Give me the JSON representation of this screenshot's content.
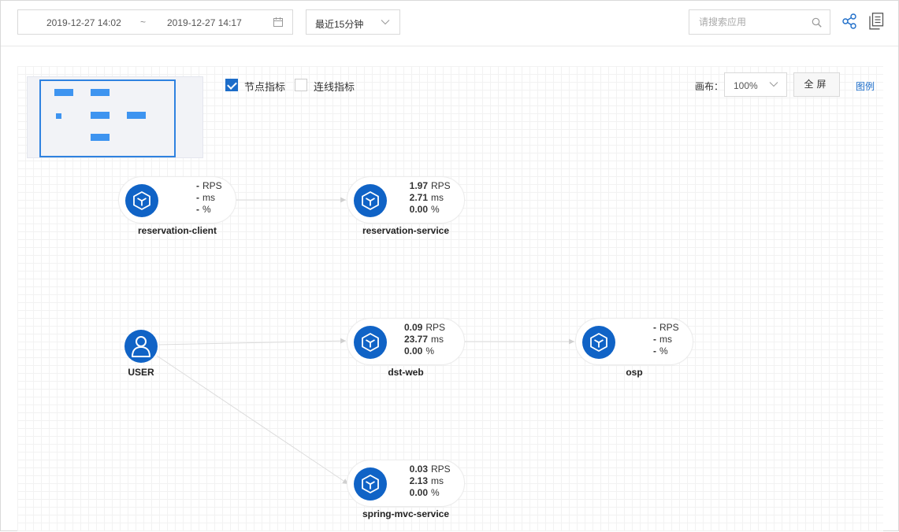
{
  "toolbar": {
    "time_range": {
      "start": "2019-12-27 14:02",
      "separator": "~",
      "end": "2019-12-27 14:17"
    },
    "period": "最近15分钟",
    "search_placeholder": "请搜索应用"
  },
  "options": {
    "node_metrics": {
      "label": "节点指标",
      "checked": true
    },
    "link_metrics": {
      "label": "连线指标",
      "checked": false
    }
  },
  "canvas_controls": {
    "canvas_label": "画布：",
    "zoom": "100%",
    "fullscreen": "全屏",
    "legend": "图例"
  },
  "colors": {
    "accent": "#1063c6",
    "minimap_block": "#3e94f0"
  },
  "graph": {
    "user": {
      "name": "USER",
      "icon": "user-icon"
    },
    "nodes": [
      {
        "id": "reservation-client",
        "name": "reservation-client",
        "icon": "cube-icon",
        "rps": "-",
        "rps_unit": "RPS",
        "ms": "-",
        "ms_unit": "ms",
        "err": "-",
        "err_unit": "%"
      },
      {
        "id": "reservation-service",
        "name": "reservation-service",
        "icon": "cube-icon",
        "rps": "1.97",
        "rps_unit": "RPS",
        "ms": "2.71",
        "ms_unit": "ms",
        "err": "0.00",
        "err_unit": "%"
      },
      {
        "id": "dst-web",
        "name": "dst-web",
        "icon": "cube-icon",
        "rps": "0.09",
        "rps_unit": "RPS",
        "ms": "23.77",
        "ms_unit": "ms",
        "err": "0.00",
        "err_unit": "%"
      },
      {
        "id": "osp",
        "name": "osp",
        "icon": "cube-icon",
        "rps": "-",
        "rps_unit": "RPS",
        "ms": "-",
        "ms_unit": "ms",
        "err": "-",
        "err_unit": "%"
      },
      {
        "id": "spring-mvc-service",
        "name": "spring-mvc-service",
        "icon": "cube-icon",
        "rps": "0.03",
        "rps_unit": "RPS",
        "ms": "2.13",
        "ms_unit": "ms",
        "err": "0.00",
        "err_unit": "%"
      }
    ],
    "edges": [
      {
        "from": "reservation-client",
        "to": "reservation-service"
      },
      {
        "from": "USER",
        "to": "dst-web"
      },
      {
        "from": "USER",
        "to": "spring-mvc-service"
      },
      {
        "from": "dst-web",
        "to": "osp"
      }
    ]
  }
}
